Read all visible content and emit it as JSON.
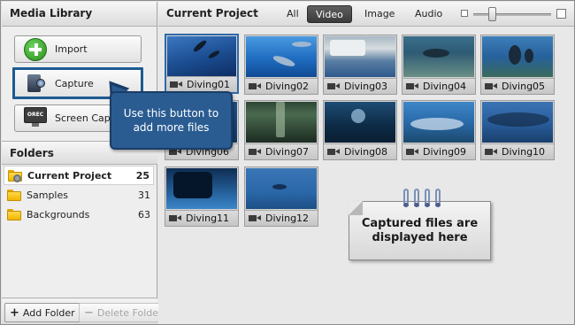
{
  "media_library": {
    "title": "Media Library",
    "buttons": {
      "import": "Import",
      "capture": "Capture",
      "screen_capture": "Screen Capture",
      "screen_capture_icon_text": "OREC"
    }
  },
  "tooltip": {
    "text": "Use this button to add more files"
  },
  "folders": {
    "title": "Folders",
    "items": [
      {
        "name": "Current Project",
        "count": "25"
      },
      {
        "name": "Samples",
        "count": "31"
      },
      {
        "name": "Backgrounds",
        "count": "63"
      }
    ],
    "add_folder": "Add Folder",
    "delete_folder": "Delete Folder"
  },
  "project": {
    "title": "Current Project",
    "filters": [
      "All",
      "Video",
      "Image",
      "Audio"
    ],
    "active_filter": "Video",
    "zoom_level": 0.2
  },
  "thumbnails": [
    {
      "name": "Diving01"
    },
    {
      "name": "Diving02"
    },
    {
      "name": "Diving03"
    },
    {
      "name": "Diving04"
    },
    {
      "name": "Diving05"
    },
    {
      "name": "Diving06"
    },
    {
      "name": "Diving07"
    },
    {
      "name": "Diving08"
    },
    {
      "name": "Diving09"
    },
    {
      "name": "Diving10"
    },
    {
      "name": "Diving11"
    },
    {
      "name": "Diving12"
    }
  ],
  "note": {
    "text": "Captured files are displayed here"
  },
  "colors": {
    "accent": "#2a5c92",
    "active_filter_bg": "#4a4a4a",
    "selection_border": "#1c5a91"
  }
}
